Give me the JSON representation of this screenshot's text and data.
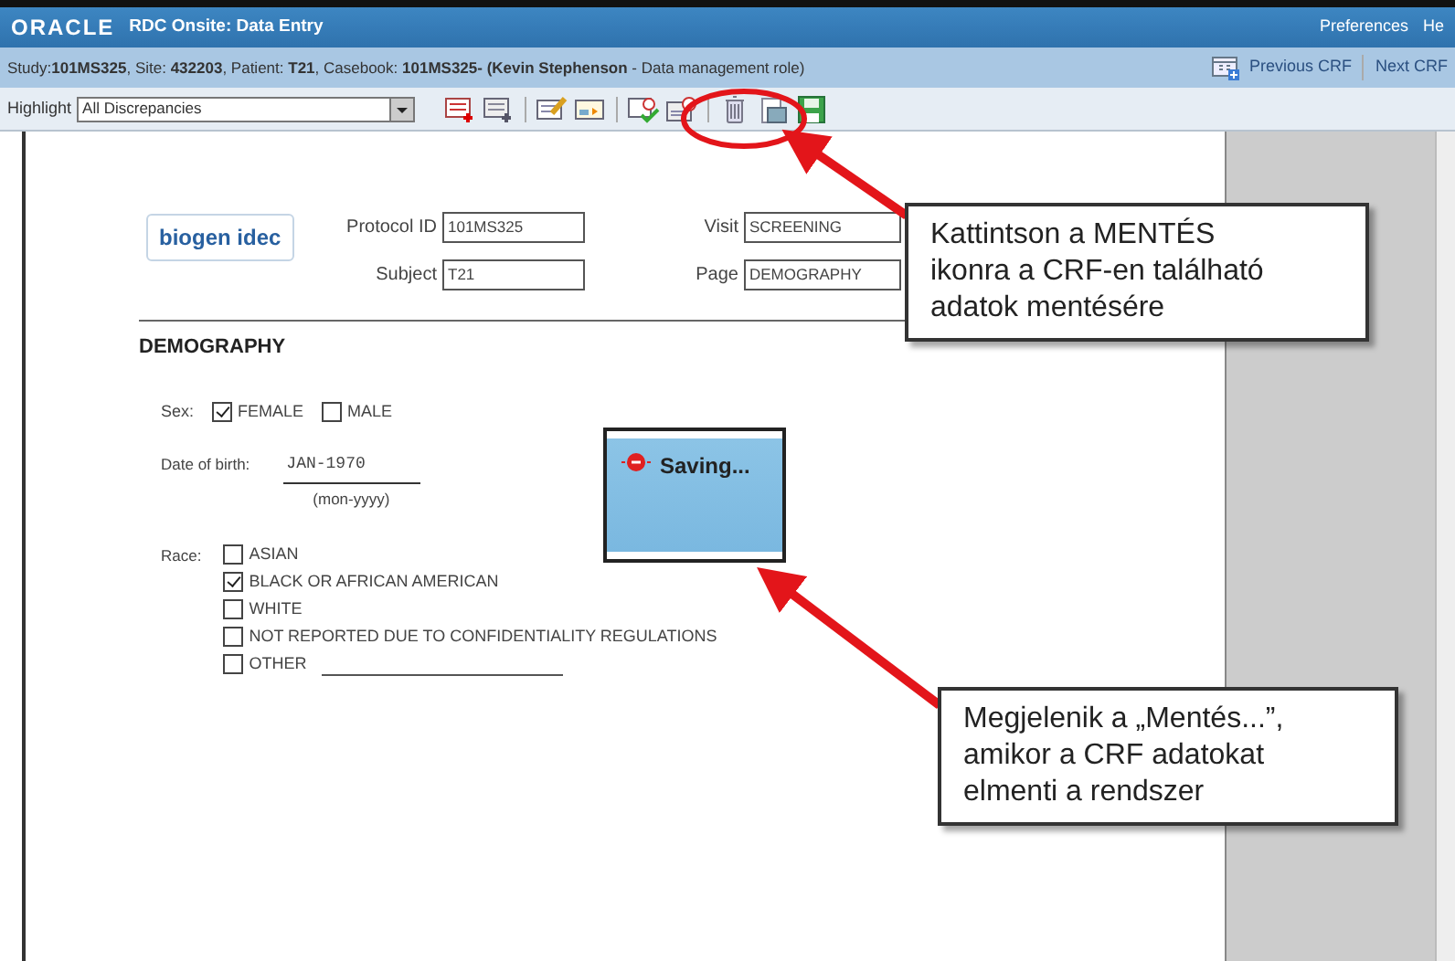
{
  "window": {
    "brand": "ORACLE",
    "title": "RDC Onsite: Data Entry",
    "header_links": [
      "Preferences",
      "He"
    ]
  },
  "context_bar": {
    "text": "Study:**101MS325**, Site: **432203**, Patient: **T21**, Casebook: **101MS325- (Kevin Stephenson** - Data management role)",
    "links": [
      "Previous CRF",
      "Next CRF"
    ]
  },
  "toolbar": {
    "label": "Highlight",
    "select_value": "All Discrepancies"
  },
  "form": {
    "logo": "biogen idec",
    "header_fields": [
      {
        "label": "Protocol ID",
        "value": "101MS325"
      },
      {
        "label": "Visit",
        "value": "SCREENING"
      },
      {
        "label": "Subject",
        "value": "T21"
      },
      {
        "label": "Page",
        "value": "DEMOGRAPHY"
      }
    ],
    "section_title": "DEMOGRAPHY",
    "sex": {
      "label": "Sex:",
      "options": [
        {
          "label": "FEMALE",
          "checked": true
        },
        {
          "label": "MALE",
          "checked": false
        }
      ]
    },
    "dob": {
      "label": "Date of birth:",
      "value": "JAN-1970",
      "hint": "(mon-yyyy)"
    },
    "race": {
      "label": "Race:",
      "options": [
        {
          "label": "ASIAN",
          "checked": false,
          "kind": "plain"
        },
        {
          "label": "BLACK OR AFRICAN AMERICAN",
          "checked": true,
          "kind": "plain"
        },
        {
          "label": "WHITE",
          "checked": false,
          "kind": "plain"
        },
        {
          "label": "NOT REPORTED DUE TO CONFIDENTIALITY REGULATIONS",
          "checked": false,
          "kind": "plain"
        },
        {
          "label": "OTHER",
          "checked": false,
          "kind": "other"
        }
      ]
    }
  },
  "saving_dialog": {
    "text": "Saving..."
  },
  "callouts": [
    {
      "text": "Kattintson a MENTÉS\nikonra a CRF-en található\nadatok mentésére"
    },
    {
      "text": "Megjelenik a „Mentés...”,\namikor a CRF adatokat\nelmenti a rendszer"
    }
  ]
}
